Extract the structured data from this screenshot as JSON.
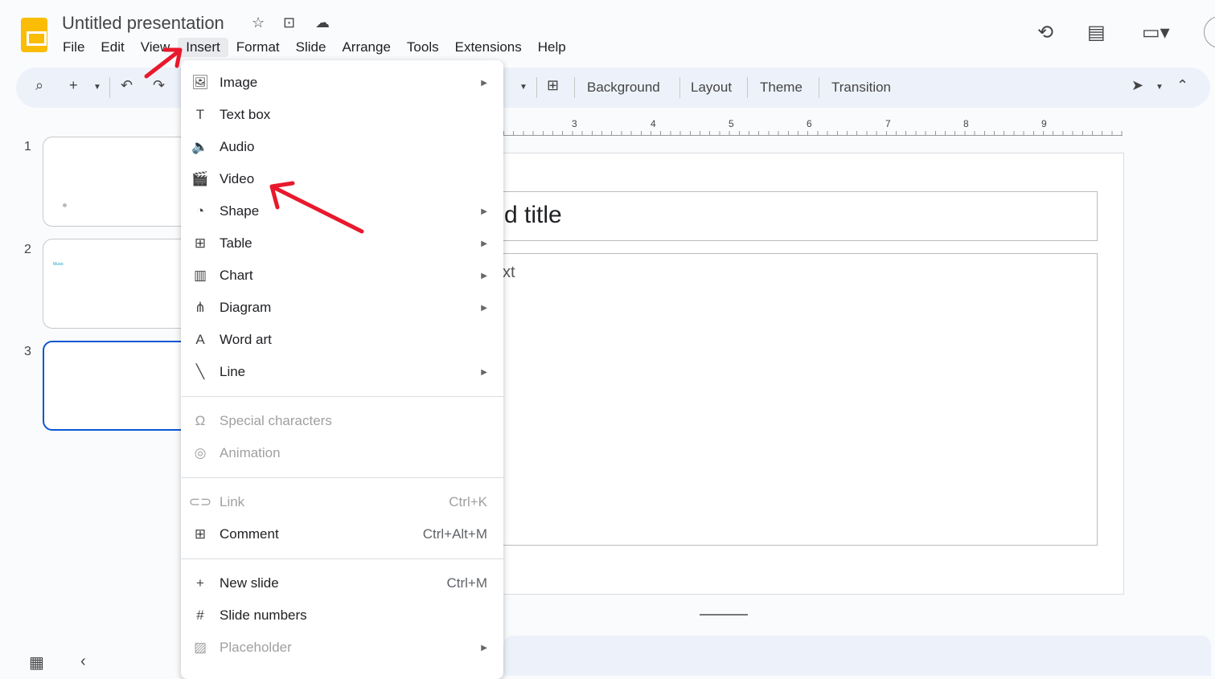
{
  "app": {
    "title": "Untitled presentation"
  },
  "menubar": [
    "File",
    "Edit",
    "View",
    "Insert",
    "Format",
    "Slide",
    "Arrange",
    "Tools",
    "Extensions",
    "Help"
  ],
  "toolbar": {
    "background": "Background",
    "layout": "Layout",
    "theme": "Theme",
    "transition": "Transition"
  },
  "ruler": [
    "3",
    "4",
    "5",
    "6",
    "7",
    "8",
    "9"
  ],
  "slides": [
    {
      "number": "1"
    },
    {
      "number": "2",
      "text": "Music"
    },
    {
      "number": "3"
    }
  ],
  "slide": {
    "title_visible": "d title",
    "body_visible": "xt"
  },
  "insert_menu": {
    "groups": [
      [
        {
          "label": "Image",
          "icon": "image-icon",
          "submenu": true
        },
        {
          "label": "Text box",
          "icon": "textbox-icon"
        },
        {
          "label": "Audio",
          "icon": "audio-icon"
        },
        {
          "label": "Video",
          "icon": "video-icon"
        },
        {
          "label": "Shape",
          "icon": "shape-icon",
          "submenu": true
        },
        {
          "label": "Table",
          "icon": "table-icon",
          "submenu": true
        },
        {
          "label": "Chart",
          "icon": "chart-icon",
          "submenu": true
        },
        {
          "label": "Diagram",
          "icon": "diagram-icon",
          "submenu": true
        },
        {
          "label": "Word art",
          "icon": "wordart-icon"
        },
        {
          "label": "Line",
          "icon": "line-icon",
          "submenu": true
        }
      ],
      [
        {
          "label": "Special characters",
          "icon": "omega-icon",
          "disabled": true
        },
        {
          "label": "Animation",
          "icon": "animation-icon",
          "disabled": true
        }
      ],
      [
        {
          "label": "Link",
          "icon": "link-icon",
          "shortcut": "Ctrl+K",
          "disabled": true
        },
        {
          "label": "Comment",
          "icon": "comment-icon",
          "shortcut": "Ctrl+Alt+M"
        }
      ],
      [
        {
          "label": "New slide",
          "icon": "plus-icon",
          "shortcut": "Ctrl+M"
        },
        {
          "label": "Slide numbers",
          "icon": "hash-icon"
        },
        {
          "label": "Placeholder",
          "icon": "placeholder-icon",
          "submenu": true,
          "disabled": true
        }
      ]
    ]
  },
  "colors": {
    "accent": "#0b57d0",
    "annotation": "#e8192c",
    "toolbar_bg": "#edf2fa"
  }
}
